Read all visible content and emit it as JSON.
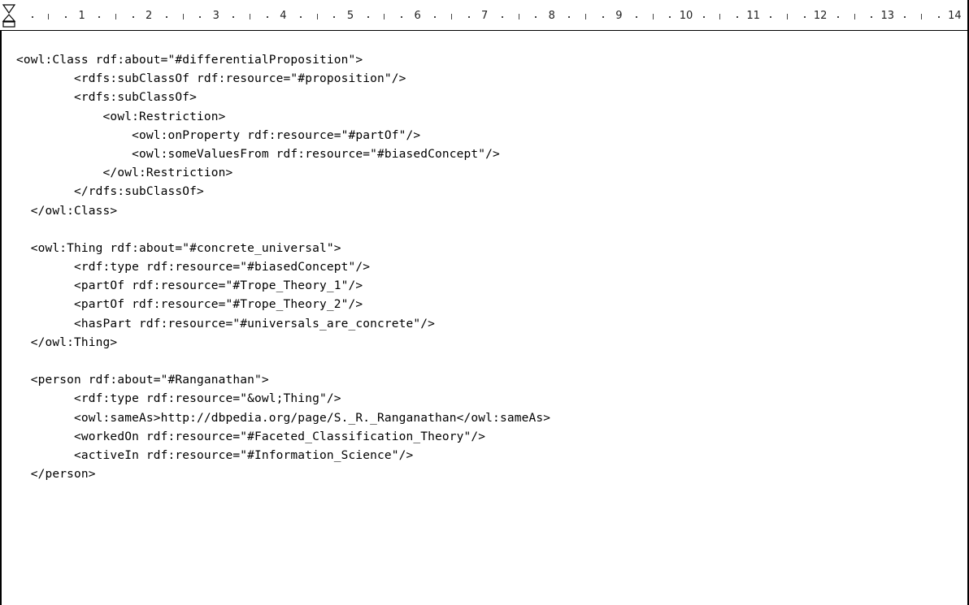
{
  "ruler": {
    "numbers": [
      "1",
      "2",
      "3",
      "4",
      "5",
      "6",
      "7",
      "8",
      "9",
      "10",
      "11",
      "12",
      "13",
      "14"
    ]
  },
  "code_lines": [
    "<owl:Class rdf:about=\"#differentialProposition\">",
    "        <rdfs:subClassOf rdf:resource=\"#proposition\"/>",
    "        <rdfs:subClassOf>",
    "            <owl:Restriction>",
    "                <owl:onProperty rdf:resource=\"#partOf\"/>",
    "                <owl:someValuesFrom rdf:resource=\"#biasedConcept\"/>",
    "            </owl:Restriction>",
    "        </rdfs:subClassOf>",
    "  </owl:Class>",
    "",
    "  <owl:Thing rdf:about=\"#concrete_universal\">",
    "        <rdf:type rdf:resource=\"#biasedConcept\"/>",
    "        <partOf rdf:resource=\"#Trope_Theory_1\"/>",
    "        <partOf rdf:resource=\"#Trope_Theory_2\"/>",
    "        <hasPart rdf:resource=\"#universals_are_concrete\"/>",
    "  </owl:Thing>",
    "",
    "  <person rdf:about=\"#Ranganathan\">",
    "        <rdf:type rdf:resource=\"&owl;Thing\"/>",
    "        <owl:sameAs>http://dbpedia.org/page/S._R._Ranganathan</owl:sameAs>",
    "        <workedOn rdf:resource=\"#Faceted_Classification_Theory\"/>",
    "        <activeIn rdf:resource=\"#Information_Science\"/>",
    "  </person>"
  ]
}
